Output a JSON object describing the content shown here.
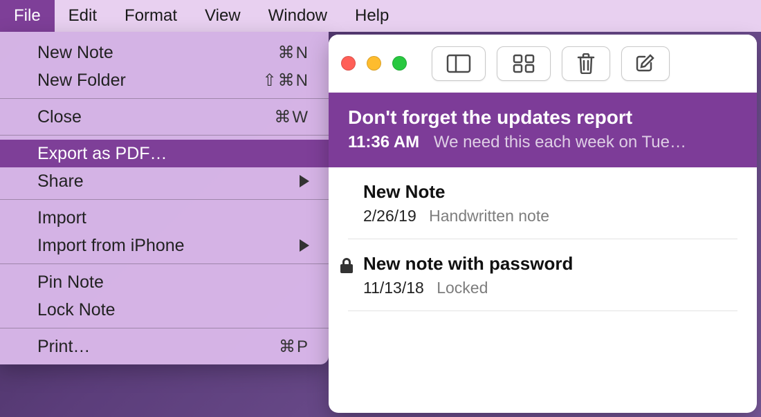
{
  "menubar": {
    "items": [
      "File",
      "Edit",
      "Format",
      "View",
      "Window",
      "Help"
    ],
    "active_index": 0
  },
  "file_menu": {
    "items": [
      {
        "label": "New Note",
        "shortcut": "⌘N",
        "submenu": false,
        "selected": false
      },
      {
        "label": "New Folder",
        "shortcut": "⇧⌘N",
        "submenu": false,
        "selected": false
      },
      {
        "sep": true
      },
      {
        "label": "Close",
        "shortcut": "⌘W",
        "submenu": false,
        "selected": false
      },
      {
        "sep": true
      },
      {
        "label": "Export as PDF…",
        "shortcut": "",
        "submenu": false,
        "selected": true
      },
      {
        "label": "Share",
        "shortcut": "",
        "submenu": true,
        "selected": false
      },
      {
        "sep": true
      },
      {
        "label": "Import",
        "shortcut": "",
        "submenu": false,
        "selected": false
      },
      {
        "label": "Import from iPhone",
        "shortcut": "",
        "submenu": true,
        "selected": false
      },
      {
        "sep": true
      },
      {
        "label": "Pin Note",
        "shortcut": "",
        "submenu": false,
        "selected": false
      },
      {
        "label": "Lock Note",
        "shortcut": "",
        "submenu": false,
        "selected": false
      },
      {
        "sep": true
      },
      {
        "label": "Print…",
        "shortcut": "⌘P",
        "submenu": false,
        "selected": false
      }
    ]
  },
  "notes_window": {
    "toolbar": {
      "icons": [
        "sidebar-icon",
        "grid-icon",
        "trash-icon",
        "compose-icon"
      ]
    },
    "notes": [
      {
        "title": "Don't forget the updates report",
        "time": "11:36 AM",
        "preview": "We need this each week on Tue…",
        "selected": true,
        "locked": false
      },
      {
        "title": "New Note",
        "time": "2/26/19",
        "preview": "Handwritten note",
        "selected": false,
        "locked": false
      },
      {
        "title": "New note with password",
        "time": "11/13/18",
        "preview": "Locked",
        "selected": false,
        "locked": true
      }
    ]
  }
}
